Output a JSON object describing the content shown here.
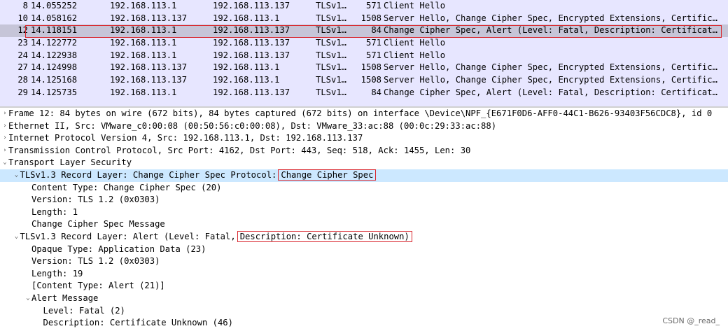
{
  "packets": [
    {
      "no": "8",
      "time": "14.055252",
      "src": "192.168.113.1",
      "dst": "192.168.113.137",
      "proto": "TLSv1…",
      "len": "571",
      "info": "Client Hello"
    },
    {
      "no": "10",
      "time": "14.058162",
      "src": "192.168.113.137",
      "dst": "192.168.113.1",
      "proto": "TLSv1…",
      "len": "1508",
      "info": "Server Hello, Change Cipher Spec, Encrypted Extensions, Certific…"
    },
    {
      "no": "12",
      "time": "14.118151",
      "src": "192.168.113.1",
      "dst": "192.168.113.137",
      "proto": "TLSv1…",
      "len": "84",
      "info": "Change Cipher Spec, Alert (Level: Fatal, Description: Certificat…",
      "selected": true
    },
    {
      "no": "23",
      "time": "14.122772",
      "src": "192.168.113.1",
      "dst": "192.168.113.137",
      "proto": "TLSv1…",
      "len": "571",
      "info": "Client Hello"
    },
    {
      "no": "24",
      "time": "14.122938",
      "src": "192.168.113.1",
      "dst": "192.168.113.137",
      "proto": "TLSv1…",
      "len": "571",
      "info": "Client Hello"
    },
    {
      "no": "27",
      "time": "14.124998",
      "src": "192.168.113.137",
      "dst": "192.168.113.1",
      "proto": "TLSv1…",
      "len": "1508",
      "info": "Server Hello, Change Cipher Spec, Encrypted Extensions, Certific…"
    },
    {
      "no": "28",
      "time": "14.125168",
      "src": "192.168.113.137",
      "dst": "192.168.113.1",
      "proto": "TLSv1…",
      "len": "1508",
      "info": "Server Hello, Change Cipher Spec, Encrypted Extensions, Certific…"
    },
    {
      "no": "29",
      "time": "14.125735",
      "src": "192.168.113.1",
      "dst": "192.168.113.137",
      "proto": "TLSv1…",
      "len": "84",
      "info": "Change Cipher Spec, Alert (Level: Fatal, Description: Certificat…"
    }
  ],
  "details": [
    {
      "indent": 0,
      "arrow": "›",
      "text": "Frame 12: 84 bytes on wire (672 bits), 84 bytes captured (672 bits) on interface \\Device\\NPF_{E671F0D6-AFF0-44C1-B626-93403F56CDC8}, id 0"
    },
    {
      "indent": 0,
      "arrow": "›",
      "text": "Ethernet II, Src: VMware_c0:00:08 (00:50:56:c0:00:08), Dst: VMware_33:ac:88 (00:0c:29:33:ac:88)"
    },
    {
      "indent": 0,
      "arrow": "›",
      "text": "Internet Protocol Version 4, Src: 192.168.113.1, Dst: 192.168.113.137"
    },
    {
      "indent": 0,
      "arrow": "›",
      "text": "Transmission Control Protocol, Src Port: 4162, Dst Port: 443, Seq: 518, Ack: 1455, Len: 30"
    },
    {
      "indent": 0,
      "arrow": "⌄",
      "text": "Transport Layer Security"
    },
    {
      "indent": 1,
      "arrow": "⌄",
      "text": "TLSv1.3 Record Layer: Change Cipher Spec Protocol:",
      "boxed": "Change Cipher Spec",
      "highlight": true
    },
    {
      "indent": 2,
      "arrow": "",
      "text": "Content Type: Change Cipher Spec (20)"
    },
    {
      "indent": 2,
      "arrow": "",
      "text": "Version: TLS 1.2 (0x0303)"
    },
    {
      "indent": 2,
      "arrow": "",
      "text": "Length: 1"
    },
    {
      "indent": 2,
      "arrow": "",
      "text": "Change Cipher Spec Message"
    },
    {
      "indent": 1,
      "arrow": "⌄",
      "text": "TLSv1.3 Record Layer: Alert (Level: Fatal,",
      "boxed": "Description: Certificate Unknown)"
    },
    {
      "indent": 2,
      "arrow": "",
      "text": "Opaque Type: Application Data (23)"
    },
    {
      "indent": 2,
      "arrow": "",
      "text": "Version: TLS 1.2 (0x0303)"
    },
    {
      "indent": 2,
      "arrow": "",
      "text": "Length: 19"
    },
    {
      "indent": 2,
      "arrow": "",
      "text": "[Content Type: Alert (21)]"
    },
    {
      "indent": 2,
      "arrow": "⌄",
      "text": "Alert Message"
    },
    {
      "indent": 3,
      "arrow": "",
      "text": "Level: Fatal (2)"
    },
    {
      "indent": 3,
      "arrow": "",
      "text": "Description: Certificate Unknown (46)"
    }
  ],
  "watermark": "CSDN @_read_",
  "colors": {
    "list_bg": "#e7e6ff",
    "selected_row": "#c6c5d8",
    "detail_highlight": "#cce8ff",
    "annotation_red": "#d9272e"
  }
}
